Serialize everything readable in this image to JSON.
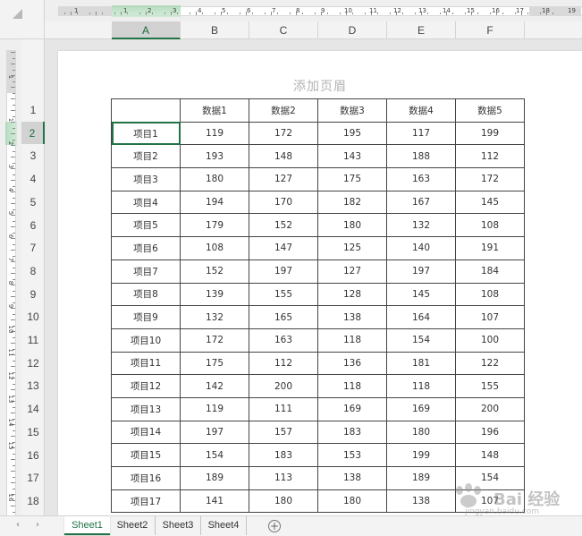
{
  "ruler": {
    "h_numbers": [
      "1",
      "1",
      "2",
      "3",
      "4",
      "5",
      "6",
      "7",
      "8",
      "9",
      "10",
      "11",
      "12",
      "13",
      "14",
      "15",
      "16",
      "17",
      "18",
      "19"
    ],
    "v_numbers": [
      "1",
      "1",
      "2",
      "3",
      "4",
      "5",
      "6",
      "7",
      "8",
      "9",
      "10",
      "11",
      "12",
      "13",
      "14",
      "15",
      "16"
    ]
  },
  "columns": [
    "A",
    "B",
    "C",
    "D",
    "E",
    "F"
  ],
  "rows": [
    "1",
    "2",
    "3",
    "4",
    "5",
    "6",
    "7",
    "8",
    "9",
    "10",
    "11",
    "12",
    "13",
    "14",
    "15",
    "16",
    "17",
    "18"
  ],
  "selection": {
    "cell": "A2",
    "column": "A",
    "row": "2"
  },
  "page": {
    "header_placeholder": "添加页眉"
  },
  "table": {
    "header": [
      "",
      "数据1",
      "数据2",
      "数据3",
      "数据4",
      "数据5"
    ],
    "rows": [
      [
        "项目1",
        "119",
        "172",
        "195",
        "117",
        "199"
      ],
      [
        "项目2",
        "193",
        "148",
        "143",
        "188",
        "112"
      ],
      [
        "项目3",
        "180",
        "127",
        "175",
        "163",
        "172"
      ],
      [
        "项目4",
        "194",
        "170",
        "182",
        "167",
        "145"
      ],
      [
        "项目5",
        "179",
        "152",
        "180",
        "132",
        "108"
      ],
      [
        "项目6",
        "108",
        "147",
        "125",
        "140",
        "191"
      ],
      [
        "项目7",
        "152",
        "197",
        "127",
        "197",
        "184"
      ],
      [
        "项目8",
        "139",
        "155",
        "128",
        "145",
        "108"
      ],
      [
        "项目9",
        "132",
        "165",
        "138",
        "164",
        "107"
      ],
      [
        "项目10",
        "172",
        "163",
        "118",
        "154",
        "100"
      ],
      [
        "项目11",
        "175",
        "112",
        "136",
        "181",
        "122"
      ],
      [
        "项目12",
        "142",
        "200",
        "118",
        "118",
        "155"
      ],
      [
        "项目13",
        "119",
        "111",
        "169",
        "169",
        "200"
      ],
      [
        "项目14",
        "197",
        "157",
        "183",
        "180",
        "196"
      ],
      [
        "项目15",
        "154",
        "183",
        "153",
        "199",
        "148"
      ],
      [
        "项目16",
        "189",
        "113",
        "138",
        "189",
        "154"
      ],
      [
        "项目17",
        "141",
        "180",
        "180",
        "138",
        "107"
      ]
    ]
  },
  "sheets": [
    {
      "label": "Sheet1",
      "active": true
    },
    {
      "label": "Sheet2",
      "active": false
    },
    {
      "label": "Sheet3",
      "active": false
    },
    {
      "label": "Sheet4",
      "active": false
    }
  ],
  "nav": {
    "prev": "‹",
    "next": "›"
  },
  "add_sheet_symbol": "+",
  "watermark": {
    "text": "Bai  经验",
    "url": "jingyan.baidu.com"
  },
  "colors": {
    "accent": "#217346",
    "selection_bg": "#d2d2d2"
  }
}
